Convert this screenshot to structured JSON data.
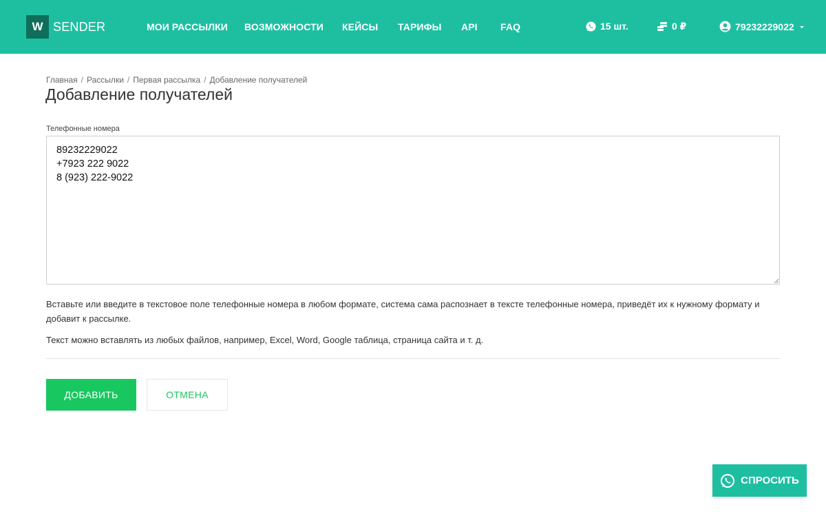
{
  "header": {
    "logo_letter": "W",
    "logo_text": "SENDER",
    "nav": [
      "МОИ РАССЫЛКИ",
      "ВОЗМОЖНОСТИ",
      "КЕЙСЫ",
      "ТАРИФЫ",
      "API",
      "FAQ"
    ],
    "messages_count": "15 шт.",
    "balance": "0 ₽",
    "user_phone": "79232229022",
    "icons": {
      "messages": "whatsapp-icon",
      "balance": "coins-icon",
      "user": "user-circle-icon",
      "dropdown": "caret-down-icon"
    }
  },
  "breadcrumb": [
    "Главная",
    "Рассылки",
    "Первая рассылка",
    "Добавление получателей"
  ],
  "page_title": "Добавление получателей",
  "form": {
    "label": "Телефонные номера",
    "value": "89232229022\n+7923 222 9022\n8 (923) 222-9022"
  },
  "help": {
    "line1": "Вставьте или введите в текстовое поле телефонные номера в любом формате, система сама распознает в тексте телефонные номера, приведёт их к нужному формату и добавит к рассылке.",
    "line2": "Текст можно вставлять из любых файлов, например, Excel, Word, Google таблица, страница сайта и т. д."
  },
  "buttons": {
    "add": "ДОБАВИТЬ",
    "cancel": "ОТМЕНА"
  },
  "chat_button": "СПРОСИТЬ",
  "colors": {
    "header": "#1ebfa1",
    "logo_box": "#0f6e5b",
    "primary": "#19c760"
  }
}
